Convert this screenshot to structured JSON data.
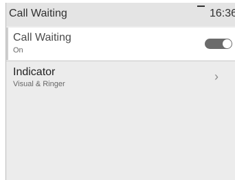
{
  "header": {
    "title": "Call Waiting",
    "time": "16:36"
  },
  "settings": {
    "items": [
      {
        "label": "Call Waiting",
        "value": "On",
        "toggle_on": true
      },
      {
        "label": "Indicator",
        "value": "Visual & Ringer",
        "chevron": "›"
      }
    ]
  },
  "colors": {
    "background": "#ececec",
    "selected_row": "#ffffff",
    "toggle_track": "#6b6b6b"
  },
  "icons": {
    "toggle": "toggle-switch-icon",
    "chevron": "chevron-right-icon",
    "status": "signal-dash-icon"
  }
}
